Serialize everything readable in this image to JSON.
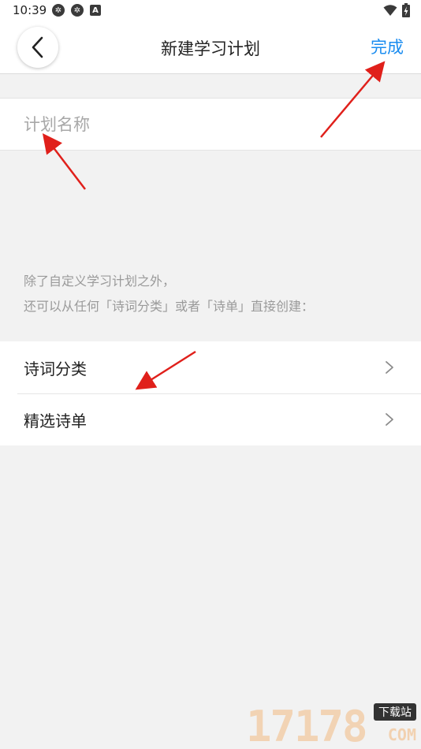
{
  "status_bar": {
    "time": "10:39",
    "left_icons": [
      "notification-icon",
      "notification-icon",
      "app-icon"
    ],
    "right_icons": [
      "wifi-icon",
      "battery-icon"
    ]
  },
  "nav": {
    "title": "新建学习计划",
    "done_label": "完成",
    "accent_color": "#1a8cf0"
  },
  "plan_name": {
    "placeholder": "计划名称",
    "value": ""
  },
  "hint": {
    "line1": "除了自定义学习计划之外，",
    "line2": "还可以从任何「诗词分类」或者「诗单」直接创建："
  },
  "menu": {
    "items": [
      {
        "label": "诗词分类",
        "icon": "chevron-right-icon"
      },
      {
        "label": "精选诗单",
        "icon": "chevron-right-icon"
      }
    ]
  },
  "watermark": {
    "digits": "17178",
    "tag": "下载站",
    "suffix": "COM"
  }
}
